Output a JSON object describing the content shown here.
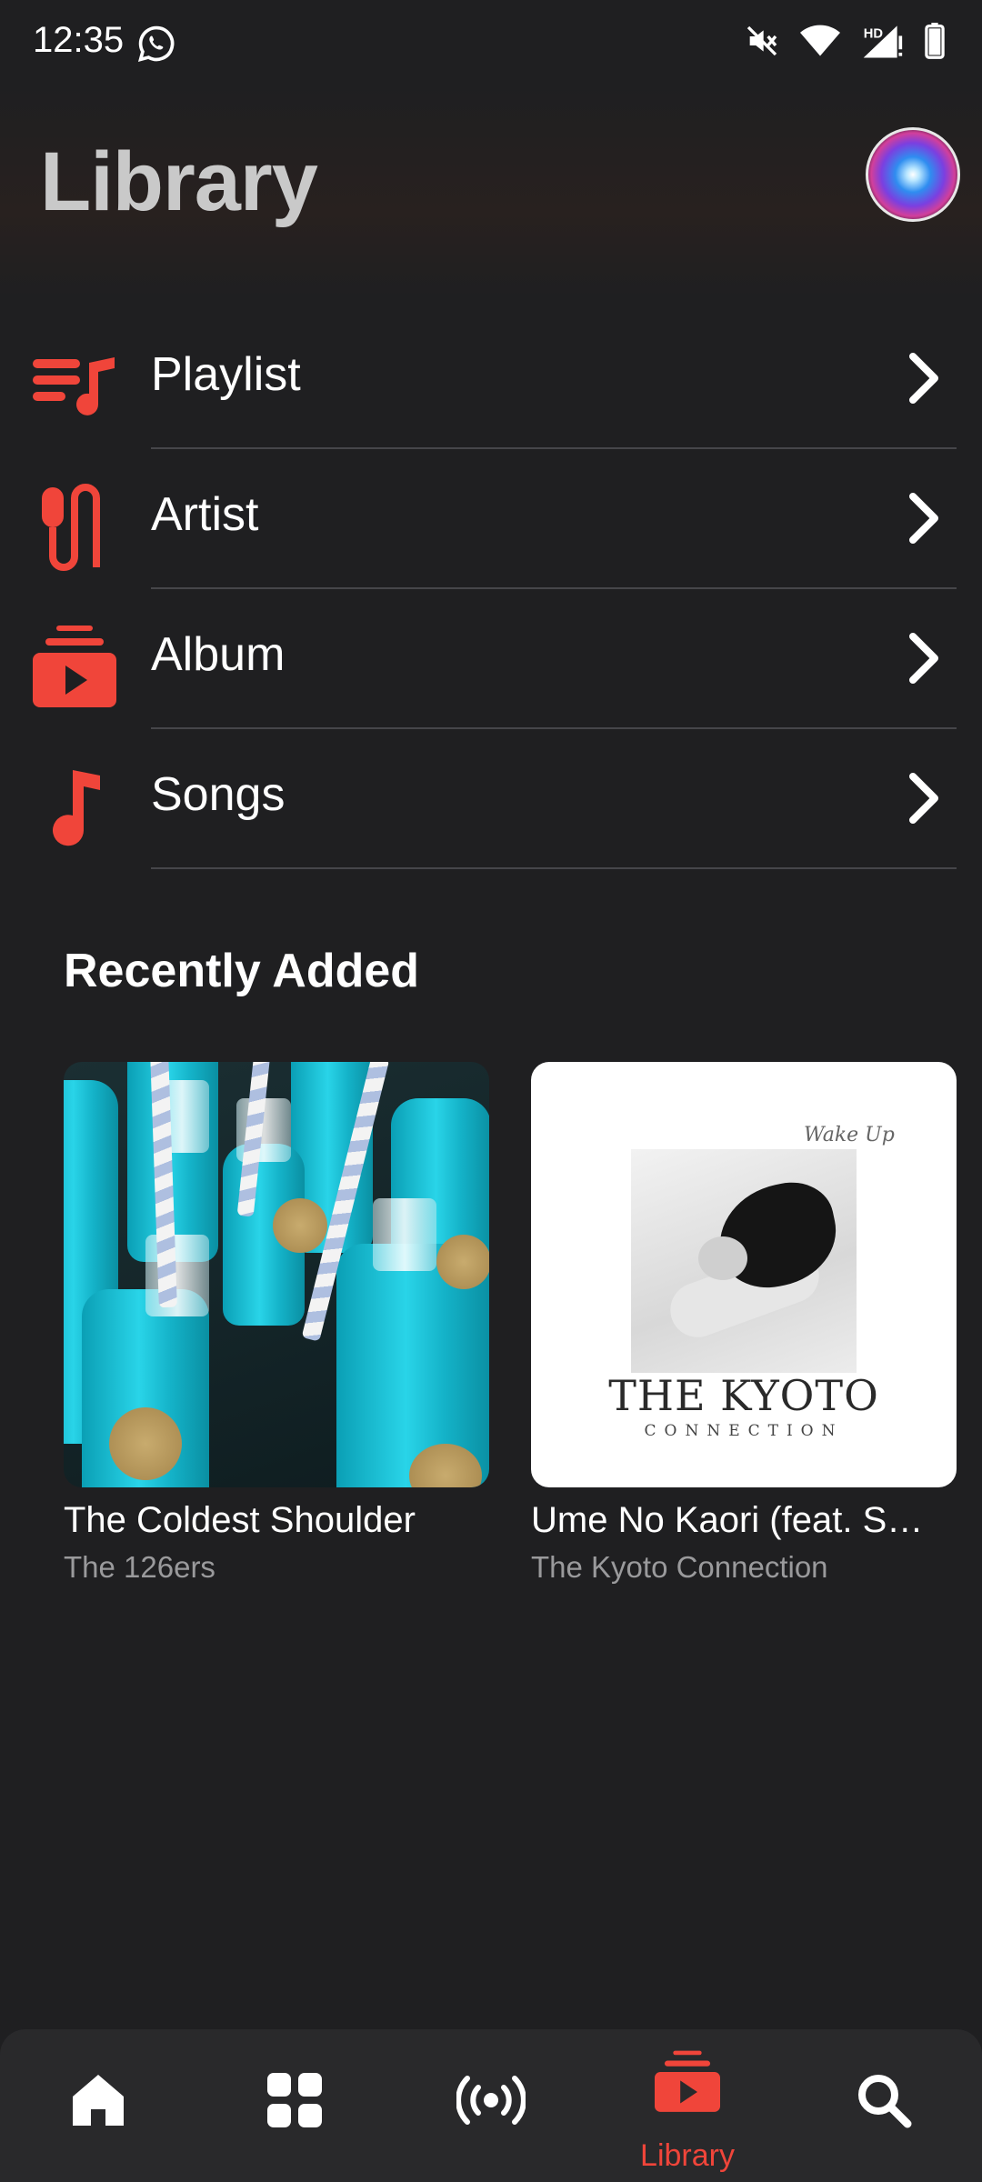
{
  "status_bar": {
    "time": "12:35",
    "icons": [
      "whatsapp-icon",
      "mute-icon",
      "wifi-icon",
      "hd-signal-icon",
      "battery-icon"
    ],
    "hd_label": "HD"
  },
  "header": {
    "title": "Library",
    "avatar": "siri-icon"
  },
  "library_list": [
    {
      "label": "Playlist",
      "icon": "playlist-icon"
    },
    {
      "label": "Artist",
      "icon": "artist-icon"
    },
    {
      "label": "Album",
      "icon": "album-icon"
    },
    {
      "label": "Songs",
      "icon": "music-note-icon"
    }
  ],
  "recently_added": {
    "title": "Recently Added",
    "items": [
      {
        "title": "The Coldest Shoulder",
        "artist": "The 126ers"
      },
      {
        "title": "Ume No Kaori (feat. S…",
        "artist": "The Kyoto Connection"
      }
    ],
    "artwork_text": {
      "wake_up": "Wake Up",
      "band": "THE KYOTO",
      "connection": "CONNECTION"
    }
  },
  "bottom_nav": {
    "items": [
      {
        "icon": "home-icon",
        "label": ""
      },
      {
        "icon": "grid-icon",
        "label": ""
      },
      {
        "icon": "radio-icon",
        "label": ""
      },
      {
        "icon": "library-icon",
        "label": "Library",
        "active": true
      },
      {
        "icon": "search-icon",
        "label": ""
      }
    ]
  },
  "colors": {
    "background": "#1f1f21",
    "accent": "#f0453a",
    "divider": "#46464a",
    "nav_background": "#29292b"
  }
}
